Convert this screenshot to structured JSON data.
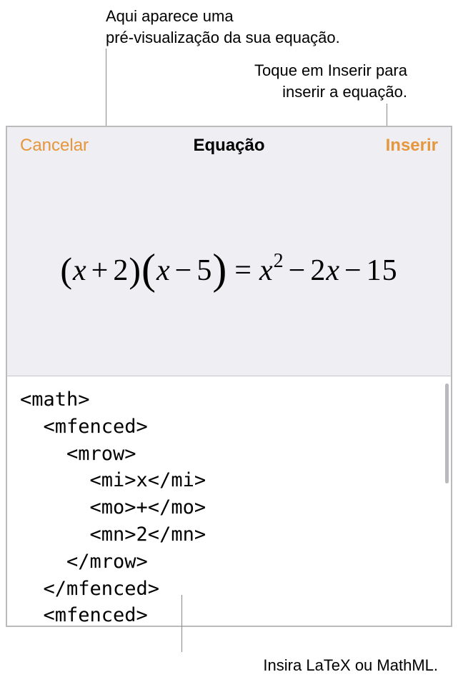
{
  "callouts": {
    "preview": "Aqui aparece uma\npré-visualização da sua equação.",
    "insert": "Toque em Inserir para\ninserir a equação.",
    "input": "Insira LaTeX ou MathML."
  },
  "dialog": {
    "cancel_label": "Cancelar",
    "title": "Equação",
    "insert_label": "Inserir"
  },
  "equation": {
    "lparen1": "(",
    "x1": "x",
    "plus1": "+",
    "two": "2",
    "rparen1": ")",
    "lparen2": "(",
    "x2": "x",
    "minus1": "−",
    "five": "5",
    "rparen2": ")",
    "equals": "=",
    "x3": "x",
    "sq": "2",
    "minus2": "−",
    "coef2": "2",
    "x4": "x",
    "minus3": "−",
    "fifteen": "15"
  },
  "code": "<math>\n  <mfenced>\n    <mrow>\n      <mi>x</mi>\n      <mo>+</mo>\n      <mn>2</mn>\n    </mrow>\n  </mfenced>\n  <mfenced>\n    <mrow>"
}
